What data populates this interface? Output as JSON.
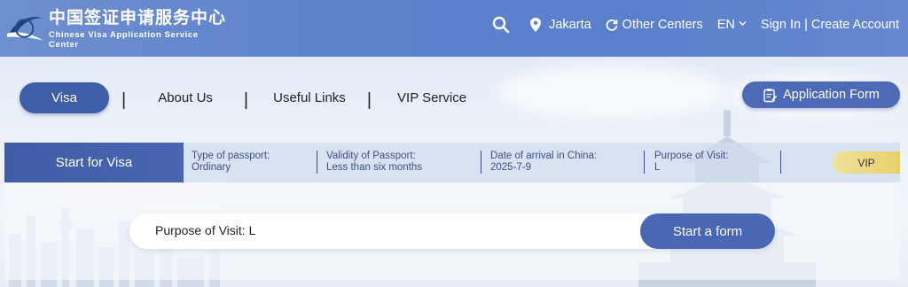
{
  "brand": {
    "name_cn": "中国签证申请服务中心",
    "name_en": "Chinese Visa Application Service Center"
  },
  "topnav": {
    "location": "Jakarta",
    "other_centers": "Other Centers",
    "language": "EN",
    "sign_in": "Sign In",
    "separator": "|",
    "create_account": "Create Account"
  },
  "mainnav": {
    "items": [
      {
        "label": "Visa",
        "active": true
      },
      {
        "label": "About Us"
      },
      {
        "label": "Useful Links"
      },
      {
        "label": "VIP Service"
      }
    ],
    "divider": "|",
    "application_form": "Application Form"
  },
  "visa_strip": {
    "title": "Start for Visa",
    "fields": [
      {
        "label": "Type of passport:",
        "value": "Ordinary"
      },
      {
        "label": "Validity of Passport:",
        "value": "Less than six months"
      },
      {
        "label": "Date of arrival in China:",
        "value": "2025-7-9"
      },
      {
        "label": "Purpose of Visit:",
        "value": "L"
      }
    ],
    "vip": "VIP"
  },
  "purpose_bar": {
    "text": "Purpose of Visit: L",
    "button": "Start a form"
  },
  "colors": {
    "header": "#5d82cc",
    "primary": "#3e5ea8",
    "vip_gold": "#ecd983"
  }
}
